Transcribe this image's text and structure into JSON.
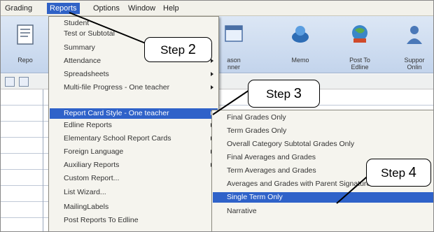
{
  "menubar": [
    "Grading",
    "Reports",
    "Options",
    "Window",
    "Help"
  ],
  "toolbar": {
    "left_label": "Repo",
    "buttons": [
      {
        "label": "ason\nnner",
        "icon": "calendar-icon"
      },
      {
        "label": "Memo",
        "icon": "memo-icon"
      },
      {
        "label": "Post To\nEdline",
        "icon": "globe-post-icon"
      },
      {
        "label": "Suppor\nOnlin",
        "icon": "support-icon"
      }
    ]
  },
  "reports_menu": [
    {
      "label": "Student",
      "submenu": false
    },
    {
      "label": "Test or Subtotal",
      "submenu": false
    },
    {
      "label": "Summary",
      "submenu": false
    },
    {
      "label": "Attendance",
      "submenu": true
    },
    {
      "label": "Spreadsheets",
      "submenu": true
    },
    {
      "label": "Multi-file Progress - One teacher",
      "submenu": true
    },
    {
      "label": "Report Card Style - One teacher",
      "submenu": true,
      "selected": true
    },
    {
      "label": "Edline Reports",
      "submenu": true
    },
    {
      "label": "Elementary School Report Cards",
      "submenu": true
    },
    {
      "label": "Foreign Language",
      "submenu": true
    },
    {
      "label": "Auxiliary Reports",
      "submenu": true
    },
    {
      "label": "Custom Report...",
      "submenu": false
    },
    {
      "label": "List Wizard...",
      "submenu": false
    },
    {
      "label": "MailingLabels",
      "submenu": false
    },
    {
      "label": "Post Reports To Edline",
      "submenu": false
    }
  ],
  "report_card_submenu": [
    {
      "label": "Final Grades Only"
    },
    {
      "label": "Term Grades Only"
    },
    {
      "label": "Overall Category Subtotal Grades Only"
    },
    {
      "label": "Final Averages and Grades"
    },
    {
      "label": "Term Averages and Grades"
    },
    {
      "label": "Averages and Grades with Parent Signature"
    },
    {
      "label": "Single Term Only",
      "selected": true
    },
    {
      "label": "Narrative"
    }
  ],
  "callouts": {
    "step2": {
      "word": "Step",
      "num": "2"
    },
    "step3": {
      "word": "Step",
      "num": "3"
    },
    "step4": {
      "word": "Step",
      "num": "4"
    }
  },
  "colors": {
    "highlight": "#2f62c9",
    "menu_bg": "#f5f4ee",
    "toolbar_top": "#dce7f5"
  }
}
